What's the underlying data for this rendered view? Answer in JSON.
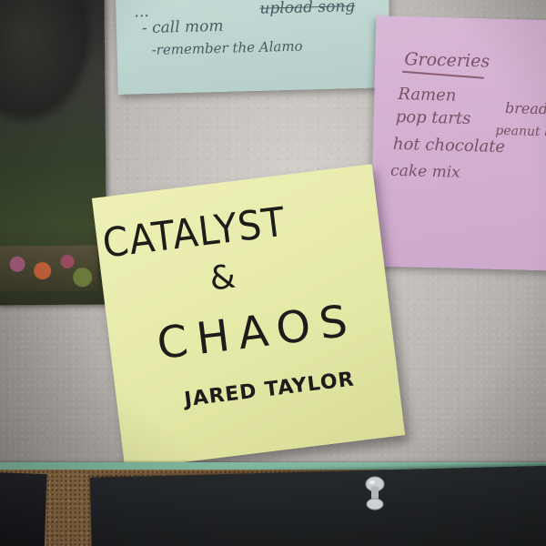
{
  "blue_note": {
    "line_1a": "...",
    "line_1b": "upload song",
    "line_2": "- call mom",
    "line_3": "-remember the Alamo"
  },
  "groceries_note": {
    "title": "Groceries",
    "items": [
      "Ramen",
      "pop tarts",
      "hot chocolate",
      "cake mix",
      "bread",
      "peanut b"
    ]
  },
  "main_note": {
    "line_1": "CATALYST",
    "line_2": "&",
    "line_3": "CHAOS",
    "line_4": "JARED TAYLOR"
  },
  "colors": {
    "yellow_note": "#e6eaa8",
    "pink_note": "#d3b0d2",
    "blue_note": "#bfd6d1",
    "cork_frame": "#7fb7a0",
    "cork": "#8a6a44"
  }
}
